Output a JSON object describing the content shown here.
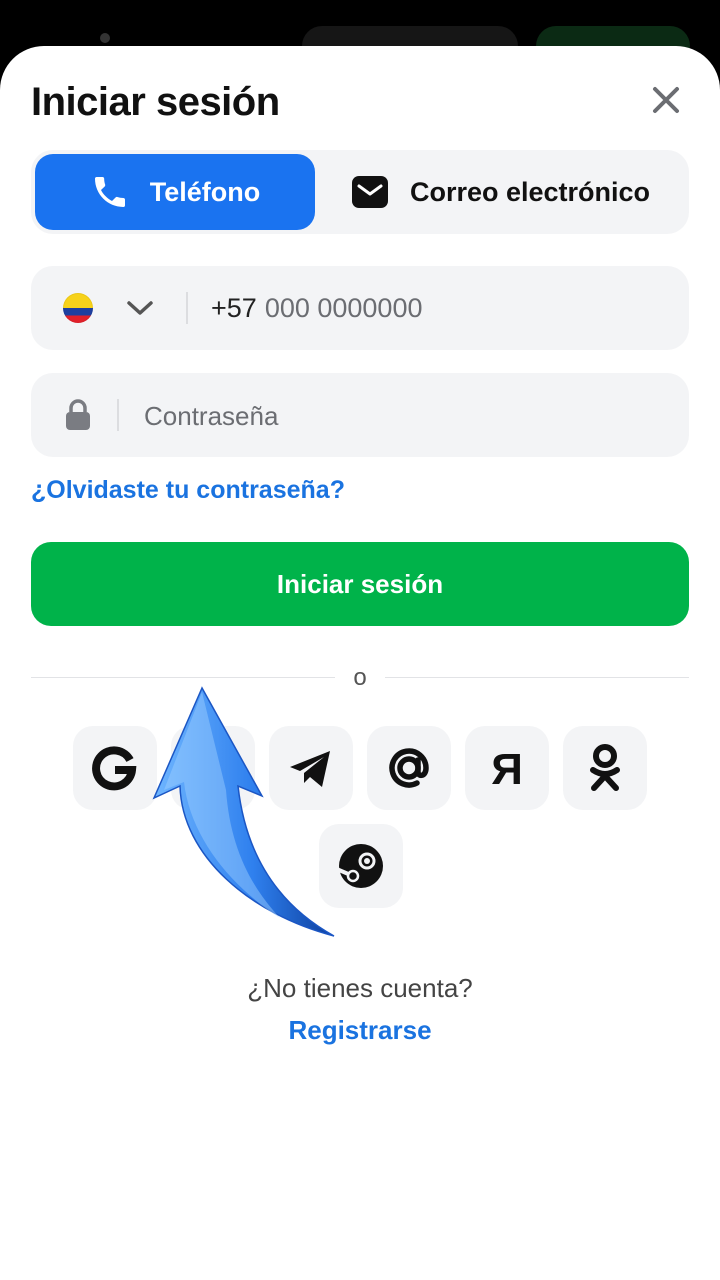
{
  "header": {
    "title": "Iniciar sesión"
  },
  "tabs": [
    {
      "label": "Teléfono",
      "icon": "phone-icon",
      "active": true
    },
    {
      "label": "Correo electrónico",
      "icon": "mail-icon",
      "active": false
    }
  ],
  "phone": {
    "country_flag": "colombia-flag-icon",
    "prefix": "+57",
    "placeholder": "000 0000000"
  },
  "password": {
    "placeholder": "Contraseña"
  },
  "forgot_link": "¿Olvidaste tu contraseña?",
  "login_button": "Iniciar sesión",
  "divider_text": "o",
  "social_logins": [
    {
      "name": "google",
      "icon": "google-icon"
    },
    {
      "name": "vk",
      "icon": "vk-icon"
    },
    {
      "name": "telegram",
      "icon": "telegram-icon"
    },
    {
      "name": "mail-ru",
      "icon": "at-sign-icon"
    },
    {
      "name": "yandex",
      "icon": "yandex-icon"
    },
    {
      "name": "odnoklassniki",
      "icon": "odnoklassniki-icon"
    },
    {
      "name": "steam",
      "icon": "steam-icon"
    }
  ],
  "footer": {
    "no_account": "¿No tienes cuenta?",
    "register": "Registrarse"
  },
  "colors": {
    "primary_blue": "#1a73f0",
    "link_blue": "#1a73e0",
    "login_green": "#00b34a",
    "field_bg": "#f3f4f6"
  }
}
